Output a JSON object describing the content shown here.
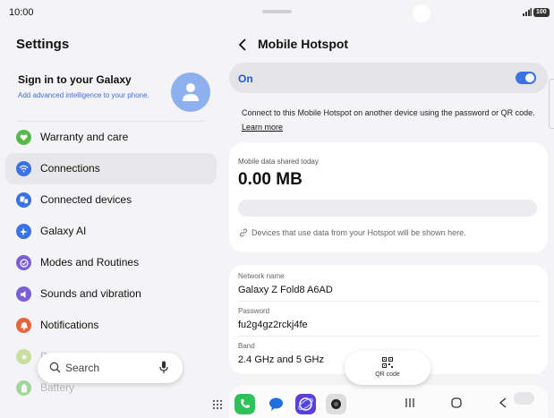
{
  "status_bar": {
    "time": "10:00",
    "battery": "100"
  },
  "left_pane": {
    "title": "Settings",
    "account": {
      "title": "Sign in to your Galaxy",
      "subtitle": "Add advanced intelligence to your phone."
    },
    "menu": [
      {
        "label": "Warranty and care",
        "icon": "heart-shield-icon",
        "color": "#59b84a"
      },
      {
        "label": "Connections",
        "icon": "wifi-icon",
        "color": "#3b72e3",
        "active": true
      },
      {
        "label": "Connected devices",
        "icon": "devices-icon",
        "color": "#3b72e3"
      },
      {
        "label": "Galaxy AI",
        "icon": "sparkle-icon",
        "color": "#3b72e3"
      },
      {
        "label": "Modes and Routines",
        "icon": "check-circle-icon",
        "color": "#7b5fd6"
      },
      {
        "label": "Sounds and vibration",
        "icon": "speaker-icon",
        "color": "#7b5fd6"
      },
      {
        "label": "Notifications",
        "icon": "bell-icon",
        "color": "#e8643c"
      },
      {
        "label": "D",
        "icon": "sun-icon",
        "color": "#9bc94a",
        "faded": true
      },
      {
        "label": "Battery",
        "icon": "battery-icon",
        "color": "#59b84a",
        "faded": true
      }
    ],
    "search": {
      "label": "Search"
    }
  },
  "right_pane": {
    "title": "Mobile Hotspot",
    "toggle": {
      "label": "On",
      "state": true
    },
    "description": "Connect to this Mobile Hotspot on another device using the password or QR code.",
    "learn_more": "Learn more",
    "data_card": {
      "caption": "Mobile data shared today",
      "value": "0.00 MB",
      "usage_fraction": 0,
      "note": "Devices that use data from your Hotspot will be shown here."
    },
    "network": {
      "name_label": "Network name",
      "name": "Galaxy Z Fold8 A6AD",
      "password_label": "Password",
      "password": "fu2g4gz2rckj4fe",
      "band_label": "Band",
      "band": "2.4 GHz and 5 GHz"
    },
    "qr_button": "QR code"
  },
  "colors": {
    "accent": "#3b72e3",
    "background": "#f4f4f6"
  }
}
